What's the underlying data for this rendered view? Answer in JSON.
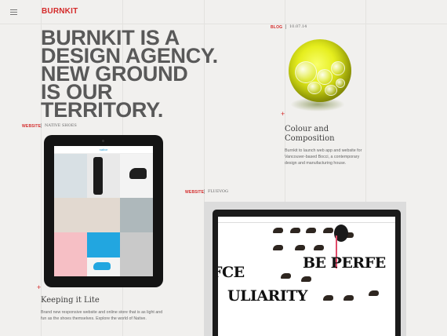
{
  "header": {
    "logo": "BURNKIT"
  },
  "hero": {
    "line1": "BURNKIT IS A",
    "line2": "DESIGN AGENCY.",
    "line3": "NEW GROUND",
    "line4": "IS OUR TERRITORY."
  },
  "blog": {
    "tag": "BLOG",
    "date": "10.07.14",
    "title_line1": "Colour and",
    "title_line2": "Composition",
    "body": "Burnkit to launch web app and website for Vancouver-based Bocci, a contemporary design and manufacturing house."
  },
  "native": {
    "tag": "WEBSITE",
    "client": "NATIVE SHOES",
    "title": "Keeping it Lite",
    "body": "Brand new responsive website and online store that is as light and fun as the shoes themselves. Explore the world of Native.",
    "screen_brand": "native"
  },
  "fluevog": {
    "tag": "WEBSITE",
    "client": "FLUEVOG",
    "screen_text1": "BE PERFE",
    "screen_text2": "ULIARITY",
    "screen_text3": "FCE"
  },
  "colors": {
    "accent": "#d42a2a",
    "orb": "#e6ee1f",
    "ipad_cyan": "#22a6e0"
  },
  "icons": {
    "menu": "hamburger-icon",
    "plus": "plus-icon"
  }
}
